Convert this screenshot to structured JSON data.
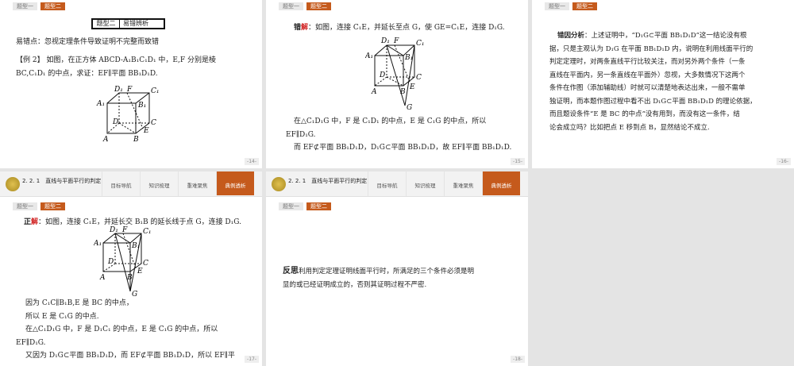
{
  "common": {
    "tab1": "题型一",
    "tab2": "题型二",
    "header_title": "2. 2. 1　直线与平面平行的判定",
    "nav": [
      "目标导航",
      "知识梳理",
      "重难聚焦",
      "典例透析"
    ]
  },
  "s14": {
    "box_left": "题型二",
    "box_right": "易错辨析",
    "point": "易错点：忽视定理条件导致证明不完整而致错",
    "example": "【例 2】 如图，在正方体 ABCD-A₁B₁C₁D₁ 中，E,F 分别是棱",
    "example2": "BC,C₁D₁ 的中点，求证：EF∥平面 BB₁D₁D.",
    "page": "-14-"
  },
  "s15": {
    "label_a": "错",
    "label_b": "解",
    "intro": "：如图，连接 C₁E，并延长至点 G，使 GE=C₁E，连接 D₁G.",
    "l1": "在△C₁D₁G 中，F 是 C₁D₁ 的中点，E 是 C₁G 的中点，所以",
    "l2": "EF∥D₁G.",
    "l3": "而 EF⊄平面 BB₁D₁D，D₁G⊂平面 BB₁D₁D，故 EF∥平面 BB₁D₁D.",
    "page": "-15-"
  },
  "s16": {
    "label": "错因分析",
    "lines": [
      "：上述证明中，“D₁G⊂平面 BB₁D₁D”这一结论没有根",
      "据，只是主观认为 D₁G 在平面 BB₁D₁D 内，说明在利用线面平行的",
      "判定定理时，对两条直线平行比较关注，而对另外两个条件（一条",
      "直线在平面内，另一条直线在平面外）忽视，大多数情况下这两个",
      "条件在作图（添加辅助线）时就可以清楚地表达出来，一般不需单",
      "独证明，而本题作图过程中看不出 D₁G⊂平面 BB₁D₁D 的理论依据，",
      "而且题设条件“E 是 BC 的中点”没有用到，而没有这一条件，结",
      "论会成立吗？比如把点 E 移到点 B，显然结论不成立."
    ],
    "page": "-16-"
  },
  "s17": {
    "label_a": "正",
    "label_b": "解",
    "intro": "：如图，连接 C₁E，并延长交 B₁B 的延长线于点 G，连接 D₁G.",
    "lines": [
      "因为 C₁C∥B₁B,E 是 BC 的中点，",
      "所以 E 是 C₁G 的中点.",
      "在△C₁D₁G 中，F 是 D₁C₁ 的中点，E 是 C₁G 的中点，所以",
      "EF∥D₁G.",
      "又因为 D₁G⊂平面 BB₁D₁D，而 EF⊄平面 BB₁D₁D，所以 EF∥平"
    ],
    "page": "-17-"
  },
  "s18": {
    "label": "反思",
    "l1": "利用判定定理证明线面平行时，所满足的三个条件必须是明",
    "l2": "显的或已经证明成立的，否则其证明过程不严密.",
    "page": "-18-"
  },
  "fig": {
    "A": "A",
    "B": "B",
    "C": "C",
    "D": "D",
    "A1": "A₁",
    "B1": "B₁",
    "C1": "C₁",
    "D1": "D₁",
    "E": "E",
    "F": "F",
    "G": "G"
  }
}
